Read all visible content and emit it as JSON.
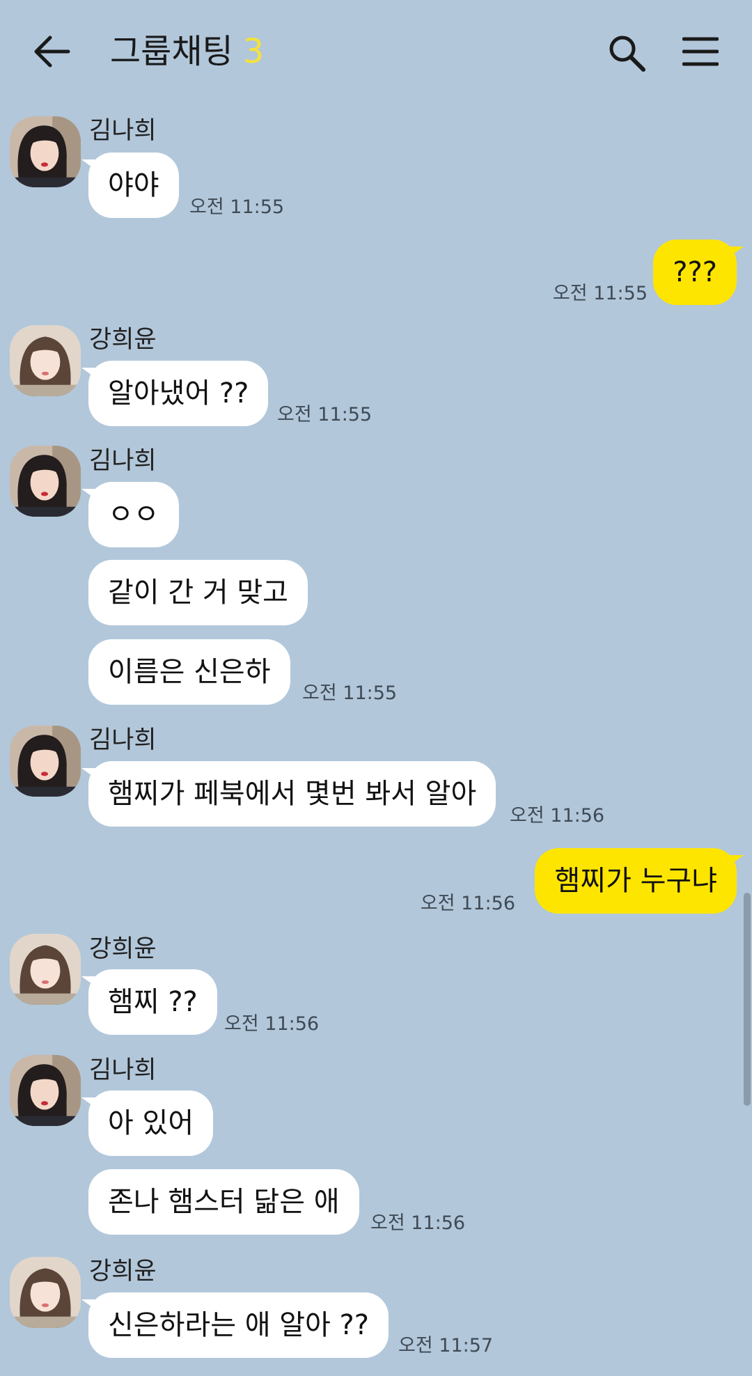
{
  "header": {
    "title": "그룹채팅",
    "member_count": "3",
    "back_icon": "arrow-left-icon",
    "search_icon": "search-icon",
    "menu_icon": "hamburger-menu-icon"
  },
  "colors": {
    "background": "#b2c7da",
    "incoming_bubble": "#ffffff",
    "outgoing_bubble": "#fee500",
    "member_count": "#f4e23b"
  },
  "messages": [
    {
      "sender": "김나희",
      "text": "야야",
      "time": "오전 11:55"
    },
    {
      "sender": "me",
      "text": "???",
      "time": "오전 11:55"
    },
    {
      "sender": "강희윤",
      "text": "알아냈어 ??",
      "time": "오전 11:55"
    },
    {
      "sender": "김나희",
      "text": "ㅇㅇ",
      "time": ""
    },
    {
      "sender": "김나희",
      "text": "같이 간 거 맞고",
      "time": ""
    },
    {
      "sender": "김나희",
      "text": "이름은 신은하",
      "time": "오전 11:55"
    },
    {
      "sender": "김나희",
      "text": "햄찌가 페북에서 몇번 봐서 알아",
      "time": "오전 11:56"
    },
    {
      "sender": "me",
      "text": "햄찌가 누구냐",
      "time": "오전 11:56"
    },
    {
      "sender": "강희윤",
      "text": "햄찌 ??",
      "time": "오전 11:56"
    },
    {
      "sender": "김나희",
      "text": "아 있어",
      "time": ""
    },
    {
      "sender": "김나희",
      "text": "존나 햄스터 닮은 애",
      "time": "오전 11:56"
    },
    {
      "sender": "강희윤",
      "text": "신은하라는 애 알아 ??",
      "time": "오전 11:57"
    }
  ]
}
